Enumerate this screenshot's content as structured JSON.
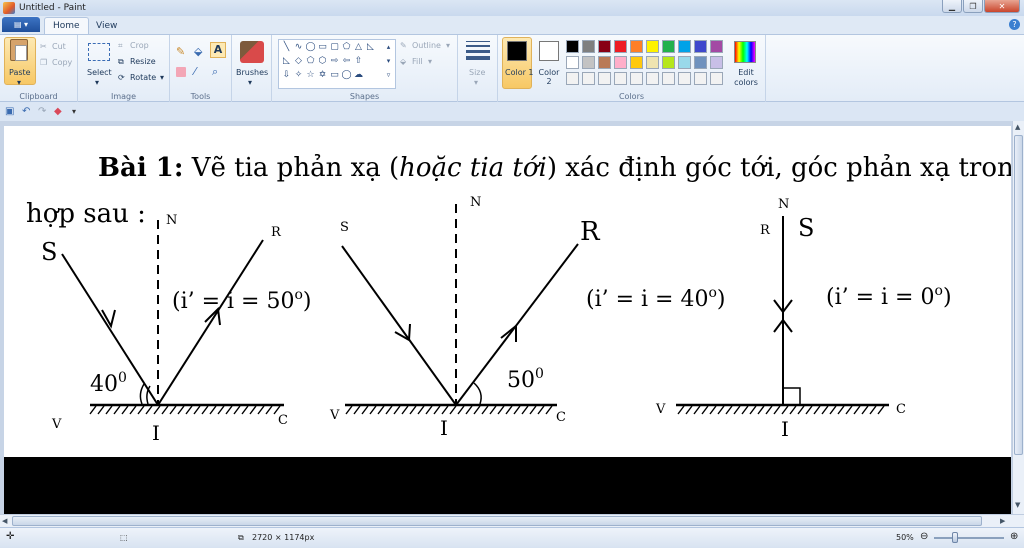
{
  "window": {
    "title": "Untitled - Paint"
  },
  "tabs": [
    "Home",
    "View"
  ],
  "clipboard": {
    "paste": "Paste",
    "cut": "Cut",
    "copy": "Copy",
    "group": "Clipboard"
  },
  "image": {
    "select": "Select",
    "crop": "Crop",
    "resize": "Resize",
    "rotate": "Rotate",
    "group": "Image"
  },
  "tools": {
    "group": "Tools"
  },
  "brushes": {
    "label": "Brushes"
  },
  "shapes": {
    "outline": "Outline",
    "fill": "Fill",
    "group": "Shapes"
  },
  "size": {
    "label": "Size"
  },
  "colors": {
    "color1": "Color 1",
    "color2": "Color 2",
    "edit": "Edit colors",
    "group": "Colors",
    "palette": [
      "#000000",
      "#7f7f7f",
      "#880015",
      "#ed1c24",
      "#ff7f27",
      "#fff200",
      "#22b14c",
      "#00a2e8",
      "#3f48cc",
      "#a349a4",
      "#ffffff",
      "#c3c3c3",
      "#b97a57",
      "#ffaec9",
      "#ffc90e",
      "#efe4b0",
      "#b5e61d",
      "#99d9ea",
      "#7092be",
      "#c8bfe7",
      "#f2f2f2",
      "#f2f2f2",
      "#f2f2f2",
      "#f2f2f2",
      "#f2f2f2",
      "#f2f2f2",
      "#f2f2f2",
      "#f2f2f2",
      "#f2f2f2",
      "#f2f2f2"
    ]
  },
  "canvas_text": {
    "heading_bold": "Bài 1:",
    "heading_a": " Vẽ tia phản xạ (",
    "heading_italic": "hoặc tia tới",
    "heading_b": ") xác định góc tới, góc phản xạ trong các trường",
    "heading_line2": "hợp sau :",
    "fig1": {
      "S": "S",
      "N": "N",
      "R": "R",
      "V": "V",
      "C": "C",
      "I": "I",
      "angle": "40",
      "angle_sup": "0",
      "eq": "(i’ = i = 50",
      "eq_sup": "o",
      "eq_end": ")"
    },
    "fig2": {
      "S": "S",
      "N": "N",
      "R": "R",
      "V": "V",
      "C": "C",
      "I": "I",
      "angle": "50",
      "angle_sup": "0",
      "eq": "(i’ = i = 40",
      "eq_sup": "o",
      "eq_end": ")"
    },
    "fig3": {
      "S": "S",
      "N": "N",
      "R": "R",
      "V": "V",
      "C": "C",
      "I": "I",
      "eq": "(i’ = i = 0",
      "eq_sup": "o",
      "eq_end": ")"
    }
  },
  "status": {
    "dimensions": "2720 × 1174px",
    "zoom": "50%"
  }
}
